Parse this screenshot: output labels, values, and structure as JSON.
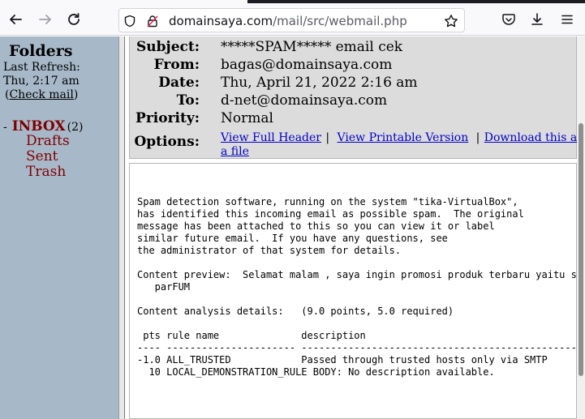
{
  "browser": {
    "url_domain": "domainsaya.com",
    "url_path": "/mail/src/webmail.php",
    "icons": [
      "back-arrow-icon",
      "forward-arrow-icon",
      "reload-icon",
      "shield-icon",
      "lock-icon",
      "star-icon",
      "pocket-icon",
      "download-icon",
      "menu-icon"
    ]
  },
  "sidebar": {
    "title": "Folders",
    "last_refresh_label": "Last Refresh:",
    "last_refresh_time": "Thu, 2:17 am",
    "paren_open": "(",
    "check_mail": "Check mail",
    "paren_close": ")",
    "inbox_dash": "-",
    "inbox_label": "INBOX",
    "inbox_count": "(2)",
    "folders": [
      "Drafts",
      "Sent",
      "Trash"
    ]
  },
  "header": {
    "subject_label": "Subject:",
    "subject_value": "*****SPAM***** email cek",
    "from_label": "From:",
    "from_value": "bagas@domainsaya.com",
    "date_label": "Date:",
    "date_value": "Thu, April 21, 2022 2:16 am",
    "to_label": "To:",
    "to_value": "d-net@domainsaya.com",
    "priority_label": "Priority:",
    "priority_value": "Normal",
    "options_label": "Options:",
    "view_full_header": "View Full Header",
    "view_printable": "View Printable Version",
    "download_line1": "Download this as",
    "download_line2": "a file",
    "separator": "|"
  },
  "message": {
    "body": "Spam detection software, running on the system \"tika-VirtualBox\",\nhas identified this incoming email as possible spam.  The original\nmessage has been attached to this so you can view it or label\nsimilar future email.  If you have any questions, see\nthe administrator of that system for details.\n\nContent preview:  Selamat malam , saya ingin promosi produk terbaru yaitu s\n   parFUM\n\nContent analysis details:   (9.0 points, 5.0 required)\n\n pts rule name              description\n---- ---------------------- --------------------------------------------------\n-1.0 ALL_TRUSTED            Passed through trusted hosts only via SMTP\n  10 LOCAL_DEMONSTRATION_RULE BODY: No description available."
  },
  "colors": {
    "sidebar_bg": "#a7b9c9",
    "folder_link": "#800000",
    "header_bg": "#dcdcdc",
    "link": "#0000cc"
  }
}
